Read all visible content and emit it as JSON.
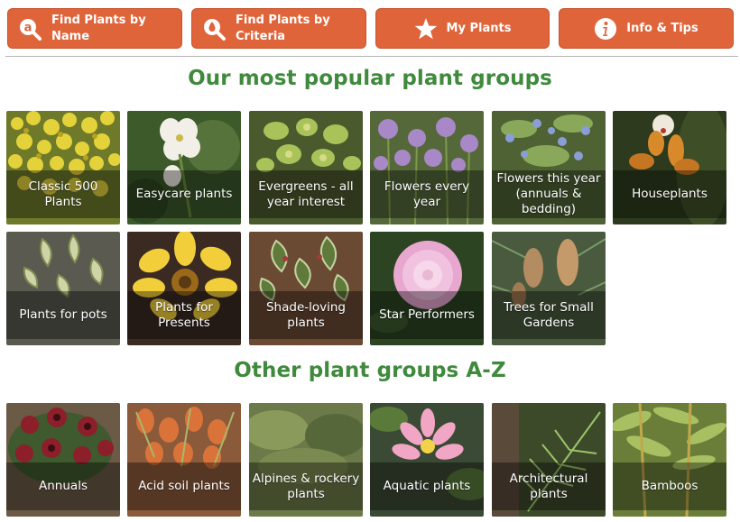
{
  "nav": {
    "find_by_name": "Find Plants by\nName",
    "find_by_criteria": "Find Plants by\nCriteria",
    "my_plants": "My Plants",
    "info_tips": "Info & Tips"
  },
  "headings": {
    "popular": "Our most popular plant groups",
    "other": "Other plant groups A-Z"
  },
  "popular_groups": [
    {
      "label": "Classic 500 Plants"
    },
    {
      "label": "Easycare plants"
    },
    {
      "label": "Evergreens - all\nyear interest"
    },
    {
      "label": "Flowers every year"
    },
    {
      "label": "Flowers this year\n(annuals &\nbedding)"
    },
    {
      "label": "Houseplants"
    },
    {
      "label": "Plants for pots"
    },
    {
      "label": "Plants for Presents"
    },
    {
      "label": "Shade-loving\nplants"
    },
    {
      "label": "Star Performers"
    },
    {
      "label": "Trees for Small\nGardens"
    }
  ],
  "other_groups": [
    {
      "label": "Annuals"
    },
    {
      "label": "Acid soil plants"
    },
    {
      "label": "Alpines & rockery\nplants"
    },
    {
      "label": "Aquatic plants"
    },
    {
      "label": "Architectural\nplants"
    },
    {
      "label": "Bamboos"
    }
  ],
  "colors": {
    "nav_bg": "#e0643a",
    "heading_green": "#3f8a3c"
  },
  "icons": {
    "find_by_name": "search-a-icon",
    "find_by_criteria": "search-drop-icon",
    "my_plants": "star-icon",
    "info_tips": "info-icon"
  }
}
